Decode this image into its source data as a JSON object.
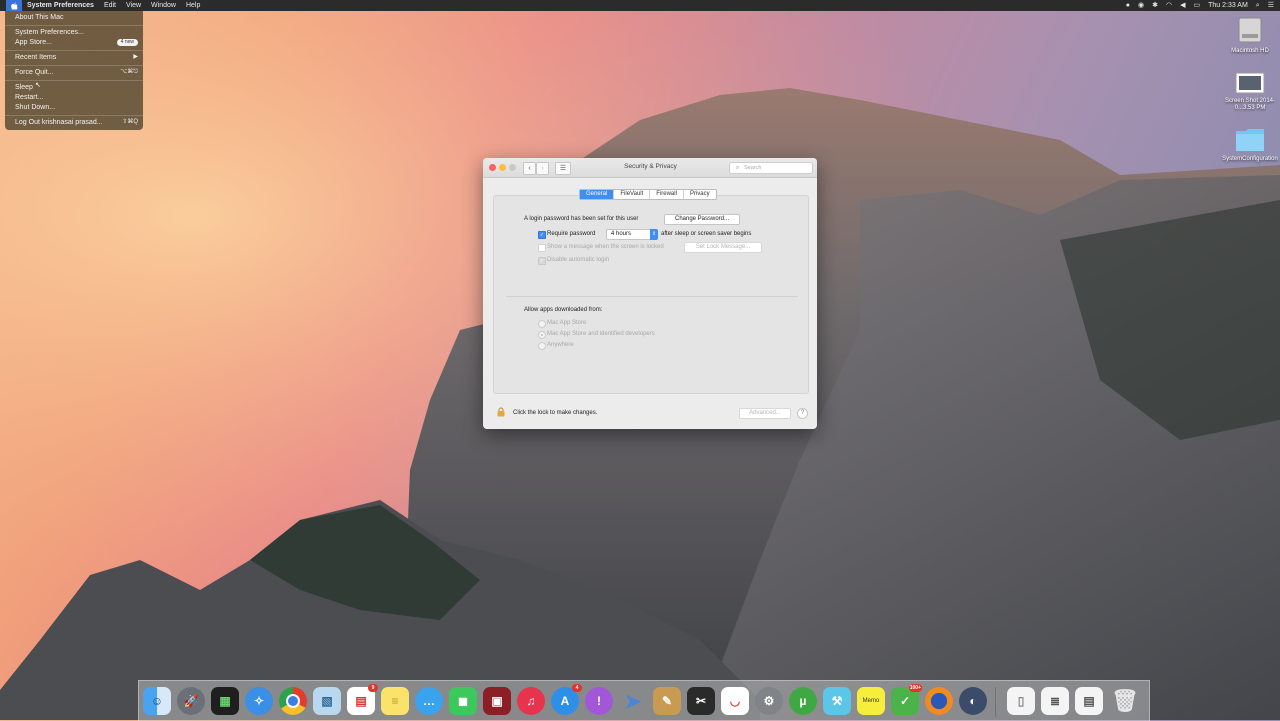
{
  "menubar": {
    "app": "System Preferences",
    "items": [
      "Edit",
      "View",
      "Window",
      "Help"
    ],
    "clock": "Thu 2:33 AM"
  },
  "apple_menu": {
    "about": "About This Mac",
    "system_prefs": "System Preferences...",
    "app_store": "App Store...",
    "app_store_badge": "4 new",
    "recent_items": "Recent Items",
    "force_quit": "Force Quit...",
    "force_quit_shortcut": "⌥⌘⎋",
    "sleep": "Sleep",
    "restart": "Restart...",
    "shut_down": "Shut Down...",
    "logout": "Log Out krishnasai prasad...",
    "logout_shortcut": "⇧⌘Q"
  },
  "window": {
    "title": "Security & Privacy",
    "search_placeholder": "Search",
    "tabs": [
      "General",
      "FileVault",
      "Firewall",
      "Privacy"
    ],
    "password_set_text": "A login password has been set for this user",
    "change_password_button": "Change Password...",
    "require_password_label": "Require password",
    "require_password_value": "4 hours",
    "after_sleep_text": "after sleep or screen saver begins",
    "show_message_label": "Show a message when the screen is locked",
    "set_lock_message_button": "Set Lock Message...",
    "disable_auto_login_label": "Disable automatic login",
    "allow_apps_title": "Allow apps downloaded from:",
    "radio_options": [
      "Mac App Store",
      "Mac App Store and identified developers",
      "Anywhere"
    ],
    "lock_text": "Click the lock to make changes.",
    "advanced_button": "Advanced...",
    "help_label": "?"
  },
  "desktop": {
    "icons": [
      {
        "label": "Macintosh HD"
      },
      {
        "label": "Screen Shot 2014-0...3.53 PM"
      },
      {
        "label": "SystemConfiguration"
      }
    ]
  },
  "dock": {
    "calendar_badge": "9",
    "appstore_badge": "4",
    "memo_label": "Memo",
    "green_badge": "100+"
  },
  "colors": {
    "accent": "#3f8ef4",
    "menubar": "#2b2b2b"
  }
}
